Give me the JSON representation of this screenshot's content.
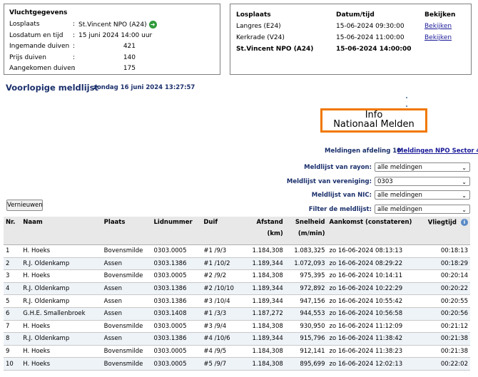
{
  "flight": {
    "header": "Vluchtgegevens",
    "rows": [
      {
        "label": "Losplaats",
        "sep": ":",
        "value": "St.Vincent NPO (A24)"
      },
      {
        "label": "Losdatum en tijd",
        "sep": ":",
        "value": "15 juni 2024 14:00 uur"
      },
      {
        "label": "Ingemande duiven",
        "sep": ":",
        "value": "421"
      },
      {
        "label": "Prijs duiven",
        "sep": ":",
        "value": "140"
      },
      {
        "label": "Aangekomen duiven",
        "sep": ":",
        "value": "175"
      }
    ]
  },
  "releases": {
    "headers": {
      "place": "Losplaats",
      "datetime": "Datum/tijd",
      "view": "Bekijken"
    },
    "rows": [
      {
        "place": "Langres (E24)",
        "datetime": "15-06-2024 09:30:00",
        "view": "Bekijken"
      },
      {
        "place": "Kerkrade (V24)",
        "datetime": "15-06-2024 11:00:00",
        "view": "Bekijken"
      },
      {
        "place": "St.Vincent NPO (A24)",
        "datetime": "15-06-2024 14:00:00",
        "view": ""
      }
    ]
  },
  "page": {
    "title": "Voorlopige meldlijst",
    "subtitle": "zondag 16 juni 2024 13:27:57"
  },
  "logo": {
    "line1": "Info",
    "line2": "Nationaal Melden"
  },
  "links": {
    "section": "Meldingen afdeling 10",
    "sector": "Meldingen NPO Sector 4"
  },
  "filters": [
    {
      "label": "Meldlijst van rayon:",
      "value": "alle meldingen"
    },
    {
      "label": "Meldlijst van vereniging:",
      "value": "0303"
    },
    {
      "label": "Meldlijst van NIC:",
      "value": "alle meldingen"
    },
    {
      "label": "Filter de meldlijst:",
      "value": "alle meldingen"
    }
  ],
  "refresh_label": "Vernieuwen",
  "table": {
    "headers": {
      "nr": "Nr.",
      "name": "Naam",
      "place": "Plaats",
      "member": "Lidnummer",
      "pigeon": "Duif",
      "distance": "Afstand",
      "distance_unit": "(km)",
      "speed": "Snelheid",
      "speed_unit": "(m/min)",
      "arrival": "Aankomst (constateren)",
      "flight_time": "Vliegtijd"
    },
    "rows": [
      {
        "nr": "1",
        "name": "H. Hoeks",
        "place": "Bovensmilde",
        "member": "0303.0005",
        "pigeon": "#1 /9/3",
        "distance": "1.184,308",
        "speed": "1.083,325",
        "arrival": "zo 16-06-2024 08:13:13",
        "time": "00:18:13"
      },
      {
        "nr": "2",
        "name": "R.J. Oldenkamp",
        "place": "Assen",
        "member": "0303.1386",
        "pigeon": "#1 /10/2",
        "distance": "1.189,344",
        "speed": "1.072,093",
        "arrival": "zo 16-06-2024 08:29:22",
        "time": "00:18:29"
      },
      {
        "nr": "3",
        "name": "H. Hoeks",
        "place": "Bovensmilde",
        "member": "0303.0005",
        "pigeon": "#2 /9/2",
        "distance": "1.184,308",
        "speed": "975,395",
        "arrival": "zo 16-06-2024 10:14:11",
        "time": "00:20:14"
      },
      {
        "nr": "4",
        "name": "R.J. Oldenkamp",
        "place": "Assen",
        "member": "0303.1386",
        "pigeon": "#2 /10/10",
        "distance": "1.189,344",
        "speed": "972,892",
        "arrival": "zo 16-06-2024 10:22:29",
        "time": "00:20:22"
      },
      {
        "nr": "5",
        "name": "R.J. Oldenkamp",
        "place": "Assen",
        "member": "0303.1386",
        "pigeon": "#3 /10/4",
        "distance": "1.189,344",
        "speed": "947,156",
        "arrival": "zo 16-06-2024 10:55:42",
        "time": "00:20:55"
      },
      {
        "nr": "6",
        "name": "G.H.E. Smallenbroek",
        "place": "Assen",
        "member": "0303.1408",
        "pigeon": "#1 /3/3",
        "distance": "1.187,272",
        "speed": "944,553",
        "arrival": "zo 16-06-2024 10:56:58",
        "time": "00:20:56"
      },
      {
        "nr": "7",
        "name": "H. Hoeks",
        "place": "Bovensmilde",
        "member": "0303.0005",
        "pigeon": "#3 /9/4",
        "distance": "1.184,308",
        "speed": "930,950",
        "arrival": "zo 16-06-2024 11:12:09",
        "time": "00:21:12"
      },
      {
        "nr": "8",
        "name": "R.J. Oldenkamp",
        "place": "Assen",
        "member": "0303.1386",
        "pigeon": "#4 /10/6",
        "distance": "1.189,344",
        "speed": "915,796",
        "arrival": "zo 16-06-2024 11:38:42",
        "time": "00:21:38"
      },
      {
        "nr": "9",
        "name": "H. Hoeks",
        "place": "Bovensmilde",
        "member": "0303.0005",
        "pigeon": "#4 /9/5",
        "distance": "1.184,308",
        "speed": "912,141",
        "arrival": "zo 16-06-2024 11:38:23",
        "time": "00:21:38"
      },
      {
        "nr": "10",
        "name": "H. Hoeks",
        "place": "Bovensmilde",
        "member": "0303.0005",
        "pigeon": "#5 /9/7",
        "distance": "1.184,308",
        "speed": "895,699",
        "arrival": "zo 16-06-2024 12:02:13",
        "time": "00:22:02"
      }
    ]
  },
  "icons": {
    "go": "go-arrow-icon",
    "info": "info-icon"
  },
  "colors": {
    "accent": "#f07800",
    "title": "#1a2f6b",
    "link": "#1a1a99"
  }
}
